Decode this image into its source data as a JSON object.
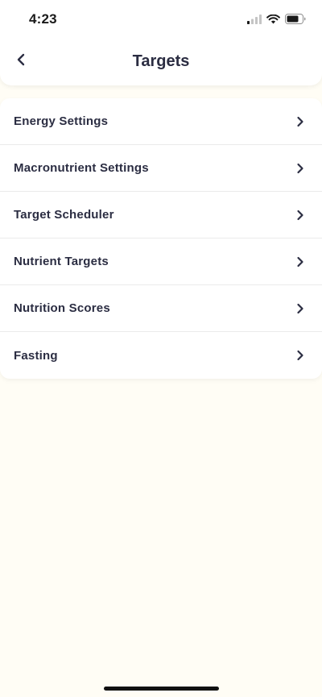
{
  "status_bar": {
    "time": "4:23",
    "icons": [
      "cellular-signal-icon",
      "wifi-icon",
      "battery-icon"
    ]
  },
  "header": {
    "title": "Targets",
    "back_icon": "chevron-left-icon"
  },
  "menu": {
    "items": [
      {
        "label": "Energy Settings",
        "icon": "chevron-right-icon"
      },
      {
        "label": "Macronutrient Settings",
        "icon": "chevron-right-icon"
      },
      {
        "label": "Target Scheduler",
        "icon": "chevron-right-icon"
      },
      {
        "label": "Nutrient Targets",
        "icon": "chevron-right-icon"
      },
      {
        "label": "Nutrition Scores",
        "icon": "chevron-right-icon"
      },
      {
        "label": "Fasting",
        "icon": "chevron-right-icon"
      }
    ]
  },
  "colors": {
    "background": "#fffdf5",
    "surface": "#ffffff",
    "text": "#2b2d42",
    "divider": "#ebebeb"
  }
}
